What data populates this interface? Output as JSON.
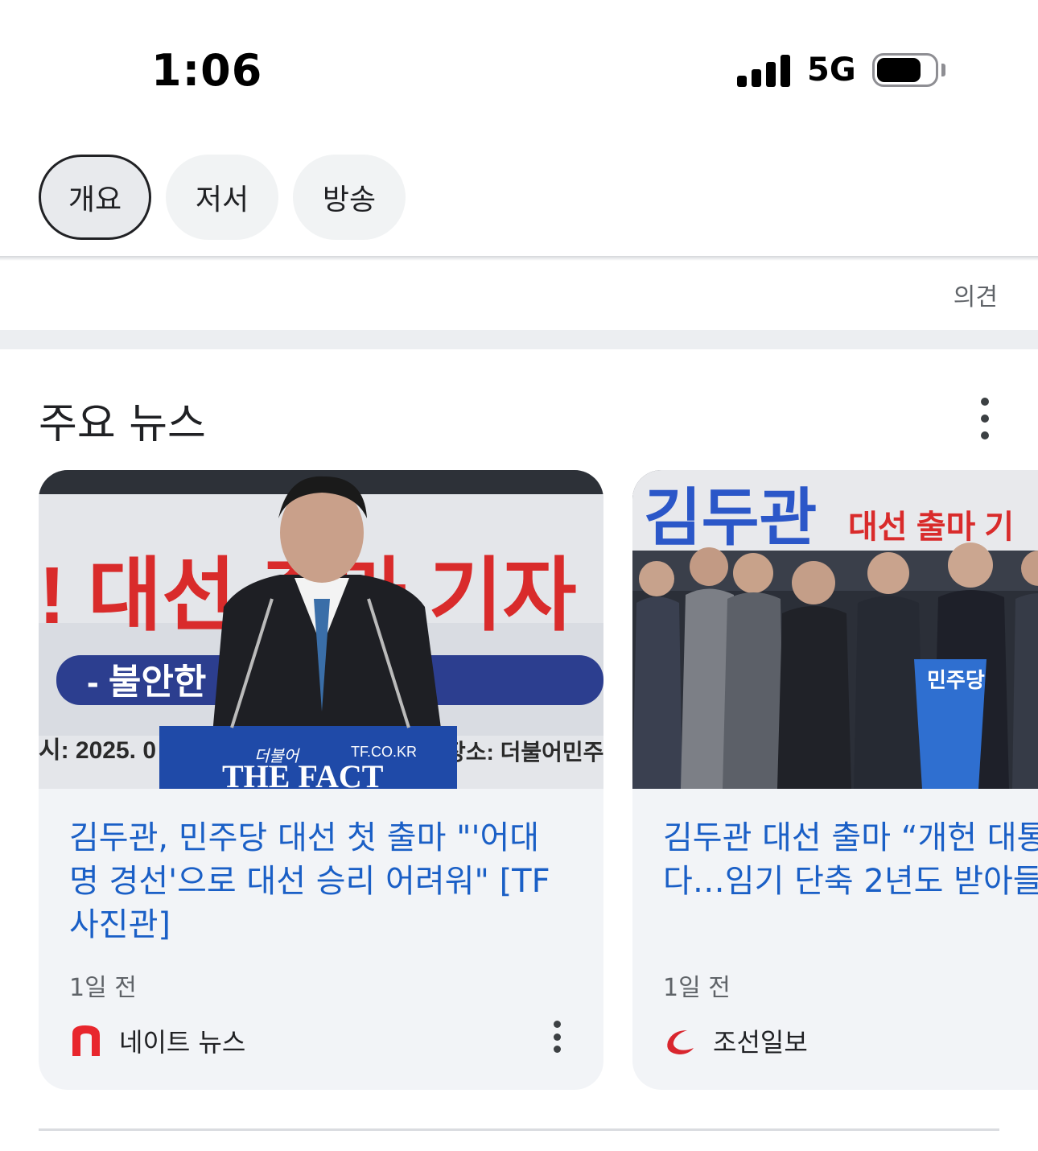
{
  "status_bar": {
    "time": "1:06",
    "network": "5G"
  },
  "chips": [
    {
      "label": "개요",
      "active": true
    },
    {
      "label": "저서",
      "active": false
    },
    {
      "label": "방송",
      "active": false
    }
  ],
  "feedback_label": "의견",
  "section": {
    "title": "주요 뉴스"
  },
  "cards": [
    {
      "headline": "김두관, 민주당 대선 첫 출마 \"'어대명 경선'으로 대선 승리 어려워\" [TF사진관]",
      "headline_lines": [
        "김두관, 민주당 대선 첫 출마 \"'어대",
        "명 경선'으로 대선 승리 어려워\" [TF",
        "사진관]"
      ],
      "time": "1일 전",
      "source": "네이트 뉴스",
      "image_text": {
        "banner_big": "! 대선 출마 기자",
        "banner_sub": "- 불안한 … 김두관! -",
        "date_line": "시: 2025. 0",
        "podium_logo": "THE FACT",
        "podium_small": "TF.CO.KR",
        "podium_script": "더불어",
        "place": "장소: 더불어민주"
      }
    },
    {
      "headline": "김두관 대선 출마 “개헌 대통 다…임기 단축 2년도 받아들",
      "headline_lines": [
        "김두관 대선 출마 “개헌 대통",
        "다…임기 단축 2년도 받아들"
      ],
      "time": "1일 전",
      "source": "조선일보",
      "image_text": {
        "banner_name": "김두관",
        "banner_rest": "대선 출마 기",
        "podium": "민주당"
      }
    }
  ],
  "colors": {
    "headline": "#1a5fc6",
    "card_bg": "#f2f4f7",
    "nate_red": "#e8262d",
    "chosun_red": "#d9262e"
  },
  "icons": [
    "signal-icon",
    "battery-icon",
    "more-vert-icon",
    "nate-logo-icon",
    "chosun-logo-icon"
  ]
}
